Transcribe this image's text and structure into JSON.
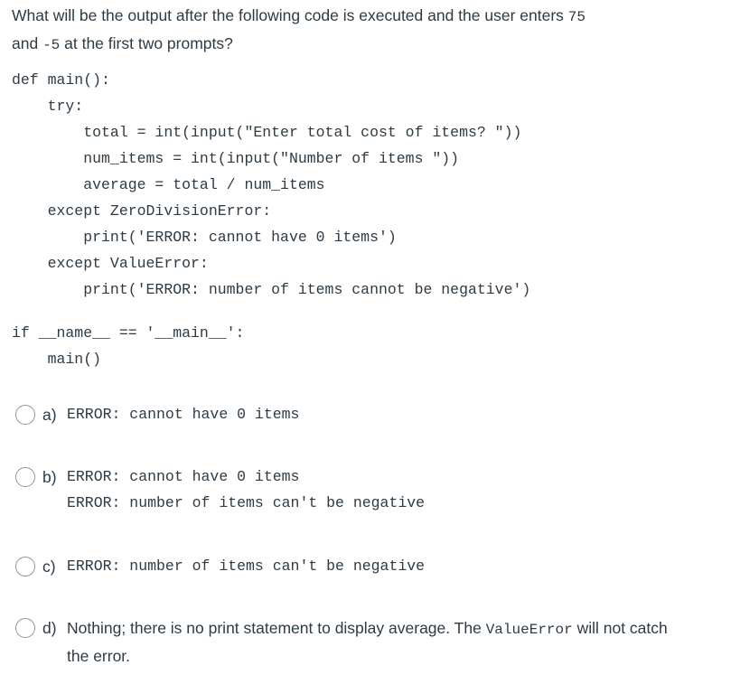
{
  "question": {
    "text_part1": "What will be the output after the following code is executed and the user enters ",
    "input_value_1": "75",
    "text_part2": "and ",
    "input_value_2": "-5",
    "text_part3": " at the first two prompts?"
  },
  "code": {
    "lines": [
      "def main():",
      "    try:",
      "        total = int(input(\"Enter total cost of items? \"))",
      "        num_items = int(input(\"Number of items \"))",
      "        average = total / num_items",
      "    except ZeroDivisionError:",
      "        print('ERROR: cannot have 0 items')",
      "    except ValueError:",
      "        print('ERROR: number of items cannot be negative')",
      "",
      "if __name__ == '__main__':",
      "    main()"
    ]
  },
  "options": [
    {
      "letter": "a)",
      "lines": [
        "ERROR: cannot have 0 items"
      ],
      "selected": false
    },
    {
      "letter": "b)",
      "lines": [
        "ERROR: cannot have 0 items",
        "ERROR: number of items can't be negative"
      ],
      "selected": false
    },
    {
      "letter": "c)",
      "lines": [
        "ERROR: number of items can't be negative"
      ],
      "selected": false
    },
    {
      "letter": "d)",
      "prose_part1": "Nothing; there is no print statement to display average. The ",
      "prose_code": "ValueError",
      "prose_part2": " will not catch the error.",
      "selected": false
    }
  ],
  "colors": {
    "text": "#2d3b45",
    "radio_border": "#8b969e"
  }
}
